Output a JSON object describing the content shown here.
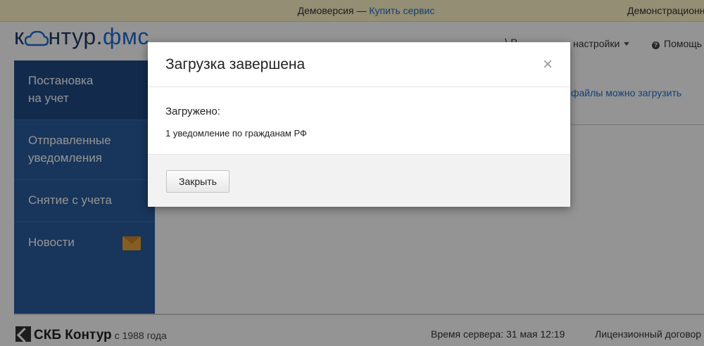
{
  "banner": {
    "demo_text": "Демоверсия — ",
    "buy_link": "Купить сервис",
    "right_text": "Демонстрационный"
  },
  "header": {
    "logo_prefix": "к",
    "logo_suffix": "нтур.",
    "logo_product": "фмс",
    "partial_text": "⟩ Р",
    "settings_label": "настройки",
    "help_label": "Помощь"
  },
  "sidebar": {
    "items": [
      {
        "label_line1": "Постановка",
        "label_line2": "на учет"
      },
      {
        "label_line1": "Отправленные",
        "label_line2": "уведомления"
      },
      {
        "label_line1": "Снятие с учета"
      },
      {
        "label_line1": "Новости"
      }
    ]
  },
  "content": {
    "link_text": "файлы можно загрузить"
  },
  "footer": {
    "brand": "СКБ Контур",
    "since": "с 1988 года",
    "server_time": "Время сервера: 31 мая 12:19",
    "license": "Лицензионный договор"
  },
  "modal": {
    "title": "Загрузка завершена",
    "close_symbol": "×",
    "label": "Загружено:",
    "result": "1 уведомление по гражданам РФ",
    "close_button": "Закрыть"
  }
}
